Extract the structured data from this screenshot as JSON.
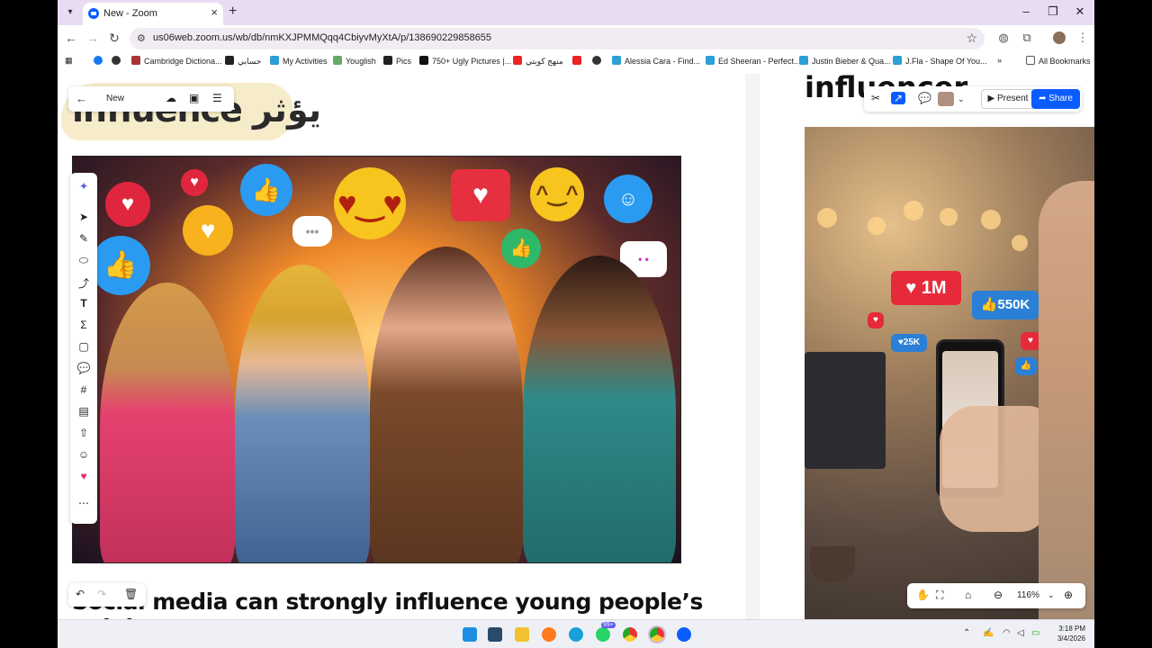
{
  "browser": {
    "tab_title": "New - Zoom",
    "url": "us06web.zoom.us/wb/db/nmKXJPMMQqq4CbiyvMyXtA/p/138690229858655",
    "bookmarks": [
      "Cambridge Dictiona...",
      "حسابي",
      "My Activities",
      "Youglish",
      "Pics",
      "750+ Ugly Pictures |...",
      "منهج كويتي",
      "Alessia Cara - Find...",
      "Ed Sheeran - Perfect...",
      "Justin Bieber & Qua...",
      "J.Fla - Shape Of You..."
    ],
    "all_bookmarks": "All Bookmarks"
  },
  "whiteboard": {
    "board_name": "New",
    "heading_left": "influence يؤثر",
    "caption_left": "Social media can strongly influence young people’s opinions",
    "heading_right": "influencer",
    "present_label": "Present",
    "share_label": "Share",
    "zoom_level": "116%",
    "bubbles": {
      "likes": "1M",
      "thumbs": "550K",
      "small": "25K"
    }
  },
  "taskbar": {
    "badge": "99+",
    "time": "3:18 PM",
    "date": "3/4/2026"
  },
  "colors": {
    "zoom_blue": "#0b5cff",
    "tab_bg": "#e9dcf2"
  }
}
